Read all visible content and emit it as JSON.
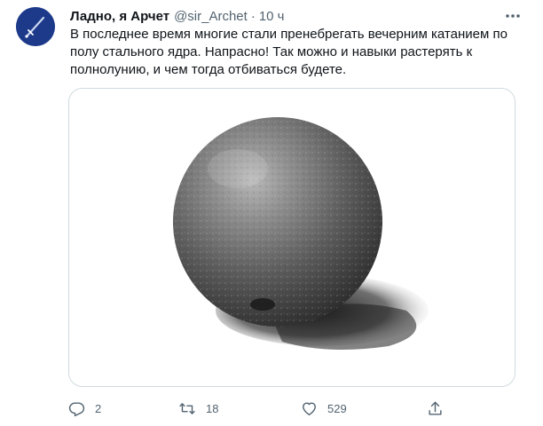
{
  "author": {
    "display_name": "Ладно, я Арчет",
    "handle": "@sir_Archet",
    "separator": "·",
    "time": "10 ч",
    "avatar_icon": "sword-avatar-icon"
  },
  "tweet": {
    "lines": [
      "В последнее время многие стали пренебрегать вечерним катанием по",
      "полу стального ядра. Напрасно! Так можно и навыки растерять к",
      "полнолунию, и чем тогда отбиваться будете."
    ],
    "media": {
      "subject": "steel ball photo"
    }
  },
  "actions": {
    "reply": {
      "icon": "reply-icon",
      "count": "2"
    },
    "retweet": {
      "icon": "retweet-icon",
      "count": "18"
    },
    "like": {
      "icon": "heart-icon",
      "count": "529"
    },
    "share": {
      "icon": "share-icon"
    }
  },
  "colors": {
    "text": "#0f1419",
    "secondary": "#536471",
    "border": "#cfd9de",
    "avatar_bg": "#1d3a8a"
  }
}
